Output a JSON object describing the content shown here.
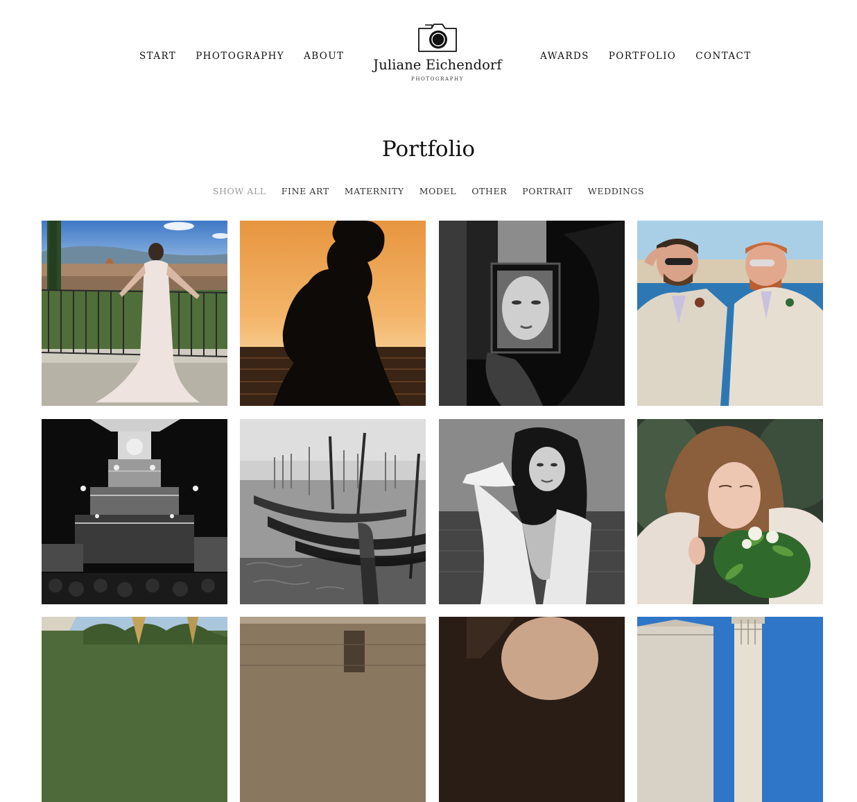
{
  "site": {
    "name": "Juliane Eichendorf",
    "tagline": "PHOTOGRAPHY",
    "logo_icon": "camera-icon"
  },
  "nav": {
    "left": [
      {
        "label": "START"
      },
      {
        "label": "PHOTOGRAPHY"
      },
      {
        "label": "ABOUT"
      }
    ],
    "right": [
      {
        "label": "AWARDS"
      },
      {
        "label": "PORTFOLIO"
      },
      {
        "label": "CONTACT"
      }
    ]
  },
  "page": {
    "title": "Portfolio"
  },
  "filters": {
    "active": "SHOW ALL",
    "items": [
      {
        "label": "SHOW ALL"
      },
      {
        "label": "FINE ART"
      },
      {
        "label": "MATERNITY"
      },
      {
        "label": "MODEL"
      },
      {
        "label": "OTHER"
      },
      {
        "label": "PORTRAIT"
      },
      {
        "label": "WEDDINGS"
      }
    ]
  },
  "gallery": [
    {
      "name": "bride-florence-terrace",
      "style": "color"
    },
    {
      "name": "maternity-silhouette-sunset",
      "style": "color"
    },
    {
      "name": "portrait-mirror-reflection",
      "style": "bw"
    },
    {
      "name": "groom-couple-seaside",
      "style": "color"
    },
    {
      "name": "christmas-pyramid-night",
      "style": "bw"
    },
    {
      "name": "venice-gondolas-fog",
      "style": "bw"
    },
    {
      "name": "model-beach-white-shirt",
      "style": "bw"
    },
    {
      "name": "bride-bouquet-fur",
      "style": "color"
    },
    {
      "name": "palm-trees-sky",
      "style": "color"
    },
    {
      "name": "stone-building-wall",
      "style": "color"
    },
    {
      "name": "dark-portrait-skin",
      "style": "color"
    },
    {
      "name": "pisa-tower-sky",
      "style": "color"
    }
  ],
  "colors": {
    "text": "#111111",
    "filter_active": "#9a9a9a",
    "background": "#ffffff"
  }
}
